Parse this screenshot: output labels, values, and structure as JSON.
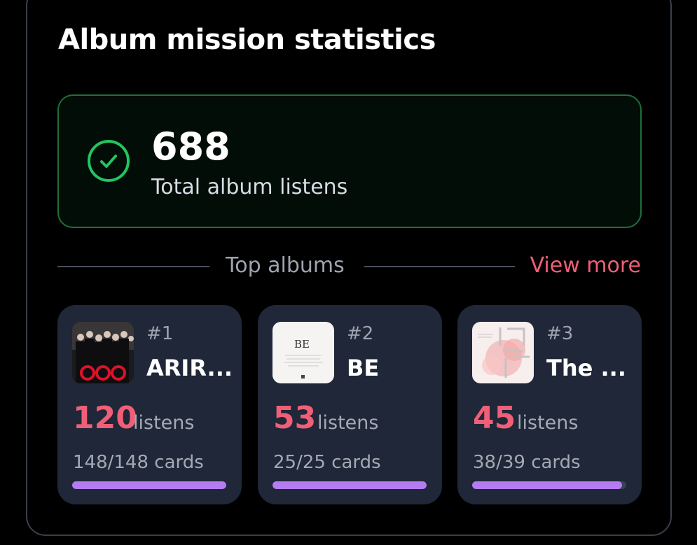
{
  "panel": {
    "title": "Album mission statistics"
  },
  "total": {
    "value": "688",
    "label": "Total album listens"
  },
  "top_albums": {
    "label": "Top albums",
    "view_more": "View more",
    "albums": [
      {
        "rank": "#1",
        "name": "ARIR...",
        "listens": "120",
        "listens_label": "listens",
        "cards": "148/148 cards",
        "progress": 1.0
      },
      {
        "rank": "#2",
        "name": "BE",
        "listens": "53",
        "listens_label": "listens",
        "cards": "25/25 cards",
        "progress": 1.0
      },
      {
        "rank": "#3",
        "name": "The ...",
        "listens": "45",
        "listens_label": "listens",
        "cards": "38/39 cards",
        "progress": 0.974
      }
    ]
  },
  "colors": {
    "accent_pink": "#ef5f77",
    "success_green": "#22c55e",
    "progress_purple": "#b57cf2",
    "card_bg": "#1f2738"
  },
  "icons": {
    "total": "check-circle-icon"
  }
}
